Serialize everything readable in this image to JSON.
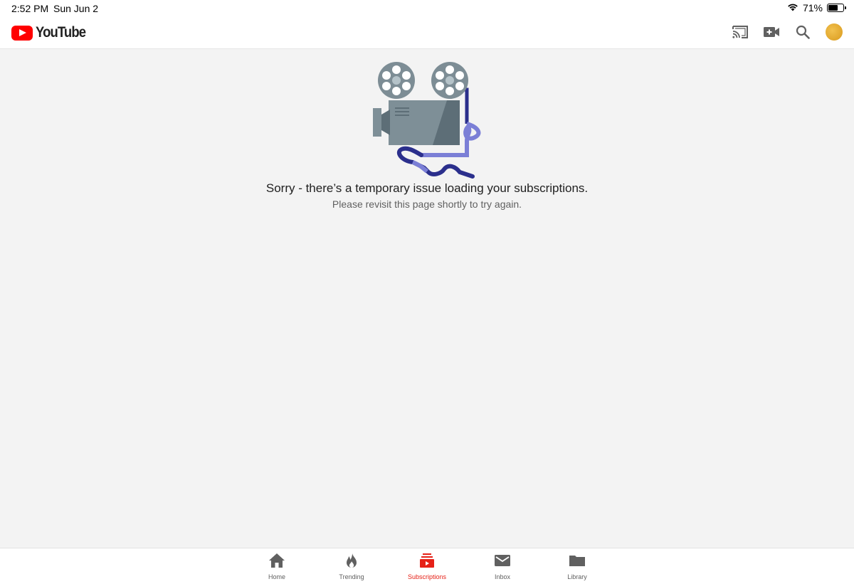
{
  "status_bar": {
    "time": "2:52 PM",
    "date": "Sun Jun 2",
    "battery_percent": "71%",
    "battery_level": 0.71
  },
  "header": {
    "logo_text": "YouTube",
    "actions": [
      "cast-icon",
      "video-camera-icon",
      "search-icon",
      "avatar"
    ]
  },
  "main": {
    "error_title": "Sorry - there’s a temporary issue loading your subscriptions.",
    "error_subtitle": "Please revisit this page shortly to try again."
  },
  "bottom_nav": {
    "items": [
      {
        "label": "Home",
        "icon": "home-icon",
        "active": false
      },
      {
        "label": "Trending",
        "icon": "flame-icon",
        "active": false
      },
      {
        "label": "Subscriptions",
        "icon": "subscriptions-icon",
        "active": true
      },
      {
        "label": "Inbox",
        "icon": "mail-icon",
        "active": false
      },
      {
        "label": "Library",
        "icon": "folder-icon",
        "active": false
      }
    ]
  },
  "colors": {
    "brand_red": "#ff0000",
    "active_tab": "#e62117",
    "icon_gray": "#606060"
  }
}
